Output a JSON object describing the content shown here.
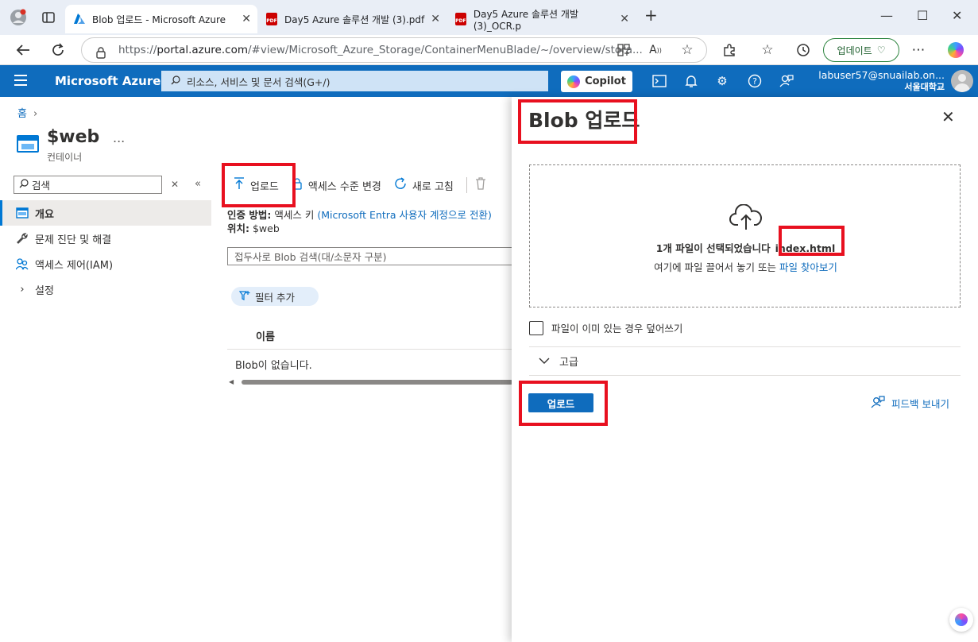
{
  "browser": {
    "tabs": [
      {
        "title": "Blob 업로드 - Microsoft Azure"
      },
      {
        "title": "Day5 Azure 솔루션 개발 (3).pdf"
      },
      {
        "title": "Day5 Azure 솔루션 개발 (3)_OCR.p"
      }
    ],
    "url_prefix": "https://",
    "url_host": "portal.azure.com",
    "url_rest": "/#view/Microsoft_Azure_Storage/ContainerMenuBlade/~/overview/stora...",
    "update_label": "업데이트",
    "pdf_badge": "PDF"
  },
  "azure": {
    "brand": "Microsoft Azure",
    "search_placeholder": "리소스, 서비스 및 문서 검색(G+/)",
    "copilot_label": "Copilot",
    "account_user": "labuser57@snuailab.on...",
    "account_org": "서울대학교",
    "colors": {
      "header": "#0f6cbd",
      "accent": "#0078d4",
      "highlight": "#e8101f"
    }
  },
  "left": {
    "breadcrumb_home": "홈",
    "resource_title": "$web",
    "resource_subtitle": "컨테이너",
    "more": "...",
    "search_placeholder": "검색",
    "nav": [
      {
        "label": "개요",
        "icon": "container-icon"
      },
      {
        "label": "문제 진단 및 해결",
        "icon": "wrench-icon"
      },
      {
        "label": "액세스 제어(IAM)",
        "icon": "people-icon"
      },
      {
        "label": "설정",
        "icon": "chevron-right-icon"
      }
    ]
  },
  "main": {
    "toolbar": {
      "upload": "업로드",
      "access_level": "액세스 수준 변경",
      "refresh": "새로 고침"
    },
    "auth_label": "인증 방법:",
    "auth_value": "액세스 키",
    "auth_link": "(Microsoft Entra 사용자 계정으로 전환)",
    "location_label": "위치:",
    "location_value": "$web",
    "blob_search_placeholder": "접두사로 Blob 검색(대/소문자 구분)",
    "add_filter": "필터 추가",
    "column_name": "이름",
    "empty_text": "Blob이 없습니다."
  },
  "panel": {
    "title": "Blob 업로드",
    "selected_text": "1개 파일이 선택되었습니다",
    "selected_file": "index.html",
    "drop_text": "여기에 파일 끌어서 놓기 또는",
    "browse_link": "파일 찾아보기",
    "overwrite_label": "파일이 이미 있는 경우 덮어쓰기",
    "overwrite_checked": false,
    "advanced_label": "고급",
    "upload_button": "업로드",
    "feedback_label": "피드백 보내기"
  }
}
